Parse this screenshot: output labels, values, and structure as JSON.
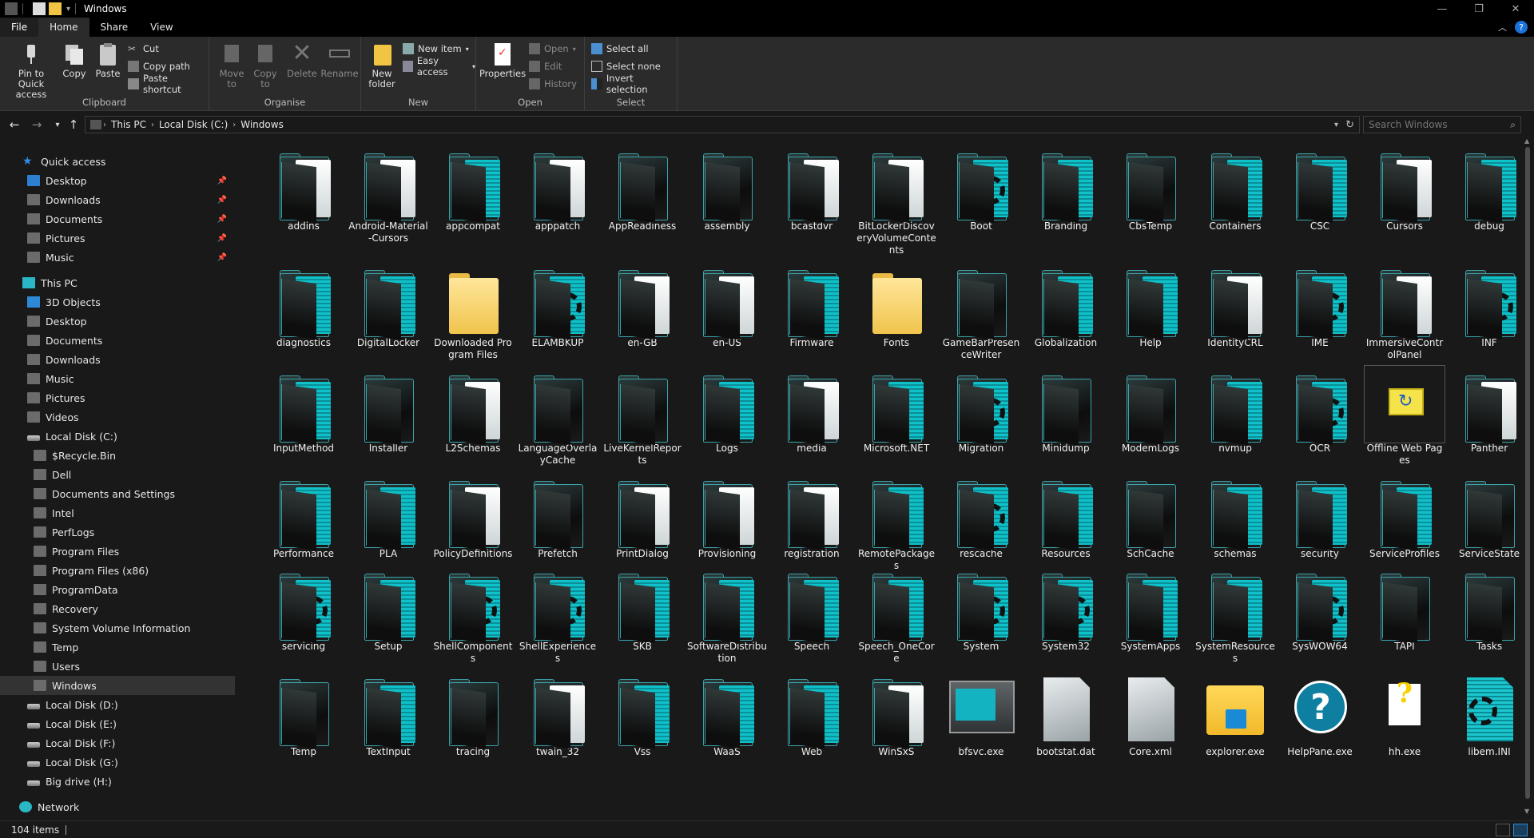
{
  "window": {
    "title": "Windows"
  },
  "tabs": {
    "file": "File",
    "home": "Home",
    "share": "Share",
    "view": "View",
    "help": "?"
  },
  "ribbon": {
    "clipboard": {
      "label": "Clipboard",
      "pin": "Pin to Quick access",
      "copy": "Copy",
      "paste": "Paste",
      "cut": "Cut",
      "copy_path": "Copy path",
      "paste_shortcut": "Paste shortcut"
    },
    "organise": {
      "label": "Organise",
      "move_to": "Move to",
      "copy_to": "Copy to",
      "delete": "Delete",
      "rename": "Rename"
    },
    "new": {
      "label": "New",
      "new_folder": "New folder",
      "new_item": "New item",
      "easy_access": "Easy access"
    },
    "open": {
      "label": "Open",
      "properties": "Properties",
      "open": "Open",
      "edit": "Edit",
      "history": "History"
    },
    "select": {
      "label": "Select",
      "select_all": "Select all",
      "select_none": "Select none",
      "invert": "Invert selection"
    }
  },
  "address": {
    "crumbs": [
      "This PC",
      "Local Disk (C:)",
      "Windows"
    ],
    "search_placeholder": "Search Windows"
  },
  "sidebar": {
    "quick_access": "Quick access",
    "quick_items": [
      "Desktop",
      "Downloads",
      "Documents",
      "Pictures",
      "Music"
    ],
    "this_pc": "This PC",
    "pc_items": [
      "3D Objects",
      "Desktop",
      "Documents",
      "Downloads",
      "Music",
      "Pictures",
      "Videos",
      "Local Disk (C:)"
    ],
    "c_items": [
      "$Recycle.Bin",
      "Dell",
      "Documents and Settings",
      "Intel",
      "PerfLogs",
      "Program Files",
      "Program Files (x86)",
      "ProgramData",
      "Recovery",
      "System Volume Information",
      "Temp",
      "Users",
      "Windows"
    ],
    "drives": [
      "Local Disk (D:)",
      "Local Disk (E:)",
      "Local Disk (F:)",
      "Local Disk (G:)",
      "Big drive (H:)"
    ],
    "network": "Network"
  },
  "items": [
    {
      "name": "addins",
      "kind": "folder-paper"
    },
    {
      "name": "Android-Material-Cursors",
      "kind": "folder-paper"
    },
    {
      "name": "appcompat",
      "kind": "folder-teal"
    },
    {
      "name": "apppatch",
      "kind": "folder-paper"
    },
    {
      "name": "AppReadiness",
      "kind": "folder"
    },
    {
      "name": "assembly",
      "kind": "folder"
    },
    {
      "name": "bcastdvr",
      "kind": "folder-paper"
    },
    {
      "name": "BitLockerDiscoveryVolumeContents",
      "kind": "folder-paper"
    },
    {
      "name": "Boot",
      "kind": "folder-gear"
    },
    {
      "name": "Branding",
      "kind": "folder-teal"
    },
    {
      "name": "CbsTemp",
      "kind": "folder"
    },
    {
      "name": "Containers",
      "kind": "folder-teal"
    },
    {
      "name": "CSC",
      "kind": "folder-teal"
    },
    {
      "name": "Cursors",
      "kind": "folder-paper"
    },
    {
      "name": "debug",
      "kind": "folder-teal"
    },
    {
      "name": "diagnostics",
      "kind": "folder-teal"
    },
    {
      "name": "DigitalLocker",
      "kind": "folder-teal"
    },
    {
      "name": "Downloaded Program Files",
      "kind": "yellow"
    },
    {
      "name": "ELAMBKUP",
      "kind": "folder-gear"
    },
    {
      "name": "en-GB",
      "kind": "folder-paper"
    },
    {
      "name": "en-US",
      "kind": "folder-paper"
    },
    {
      "name": "Firmware",
      "kind": "folder-teal"
    },
    {
      "name": "Fonts",
      "kind": "yellow"
    },
    {
      "name": "GameBarPresenceWriter",
      "kind": "folder"
    },
    {
      "name": "Globalization",
      "kind": "folder-teal"
    },
    {
      "name": "Help",
      "kind": "folder-teal"
    },
    {
      "name": "IdentityCRL",
      "kind": "folder-paper"
    },
    {
      "name": "IME",
      "kind": "folder-gear"
    },
    {
      "name": "ImmersiveControlPanel",
      "kind": "folder-paper"
    },
    {
      "name": "INF",
      "kind": "folder-gear"
    },
    {
      "name": "InputMethod",
      "kind": "folder-teal"
    },
    {
      "name": "Installer",
      "kind": "folder"
    },
    {
      "name": "L2Schemas",
      "kind": "folder-paper"
    },
    {
      "name": "LanguageOverlayCache",
      "kind": "folder"
    },
    {
      "name": "LiveKernelReports",
      "kind": "folder"
    },
    {
      "name": "Logs",
      "kind": "folder-teal"
    },
    {
      "name": "media",
      "kind": "folder-paper"
    },
    {
      "name": "Microsoft.NET",
      "kind": "folder-teal"
    },
    {
      "name": "Migration",
      "kind": "folder-gear"
    },
    {
      "name": "Minidump",
      "kind": "folder"
    },
    {
      "name": "ModemLogs",
      "kind": "folder"
    },
    {
      "name": "nvmup",
      "kind": "folder-teal"
    },
    {
      "name": "OCR",
      "kind": "folder-gear"
    },
    {
      "name": "Offline Web Pages",
      "kind": "offline"
    },
    {
      "name": "Panther",
      "kind": "folder-paper"
    },
    {
      "name": "Performance",
      "kind": "folder-teal"
    },
    {
      "name": "PLA",
      "kind": "folder-teal"
    },
    {
      "name": "PolicyDefinitions",
      "kind": "folder-paper"
    },
    {
      "name": "Prefetch",
      "kind": "folder"
    },
    {
      "name": "PrintDialog",
      "kind": "folder-paper"
    },
    {
      "name": "Provisioning",
      "kind": "folder-paper"
    },
    {
      "name": "registration",
      "kind": "folder-paper"
    },
    {
      "name": "RemotePackages",
      "kind": "folder-teal"
    },
    {
      "name": "rescache",
      "kind": "folder-gear"
    },
    {
      "name": "Resources",
      "kind": "folder-teal"
    },
    {
      "name": "SchCache",
      "kind": "folder"
    },
    {
      "name": "schemas",
      "kind": "folder-teal"
    },
    {
      "name": "security",
      "kind": "folder-teal"
    },
    {
      "name": "ServiceProfiles",
      "kind": "folder-teal"
    },
    {
      "name": "ServiceState",
      "kind": "folder"
    },
    {
      "name": "servicing",
      "kind": "folder-gear"
    },
    {
      "name": "Setup",
      "kind": "folder-teal"
    },
    {
      "name": "ShellComponents",
      "kind": "folder-gear"
    },
    {
      "name": "ShellExperiences",
      "kind": "folder-gear"
    },
    {
      "name": "SKB",
      "kind": "folder-teal"
    },
    {
      "name": "SoftwareDistribution",
      "kind": "folder-teal"
    },
    {
      "name": "Speech",
      "kind": "folder-teal"
    },
    {
      "name": "Speech_OneCore",
      "kind": "folder-teal"
    },
    {
      "name": "System",
      "kind": "folder-gear"
    },
    {
      "name": "System32",
      "kind": "folder-gear"
    },
    {
      "name": "SystemApps",
      "kind": "folder-teal"
    },
    {
      "name": "SystemResources",
      "kind": "folder-teal"
    },
    {
      "name": "SysWOW64",
      "kind": "folder-gear"
    },
    {
      "name": "TAPI",
      "kind": "folder"
    },
    {
      "name": "Tasks",
      "kind": "folder"
    },
    {
      "name": "Temp",
      "kind": "folder"
    },
    {
      "name": "TextInput",
      "kind": "folder-teal"
    },
    {
      "name": "tracing",
      "kind": "folder"
    },
    {
      "name": "twain_32",
      "kind": "folder-paper"
    },
    {
      "name": "Vss",
      "kind": "folder-teal"
    },
    {
      "name": "WaaS",
      "kind": "folder-teal"
    },
    {
      "name": "Web",
      "kind": "folder-teal"
    },
    {
      "name": "WinSxS",
      "kind": "folder-paper"
    },
    {
      "name": "bfsvc.exe",
      "kind": "monitor"
    },
    {
      "name": "bootstat.dat",
      "kind": "doc"
    },
    {
      "name": "Core.xml",
      "kind": "doc"
    },
    {
      "name": "explorer.exe",
      "kind": "explorer"
    },
    {
      "name": "HelpPane.exe",
      "kind": "help"
    },
    {
      "name": "hh.exe",
      "kind": "qdoc"
    },
    {
      "name": "libem.INI",
      "kind": "doc-teal"
    }
  ],
  "status": {
    "count": "104 items"
  }
}
